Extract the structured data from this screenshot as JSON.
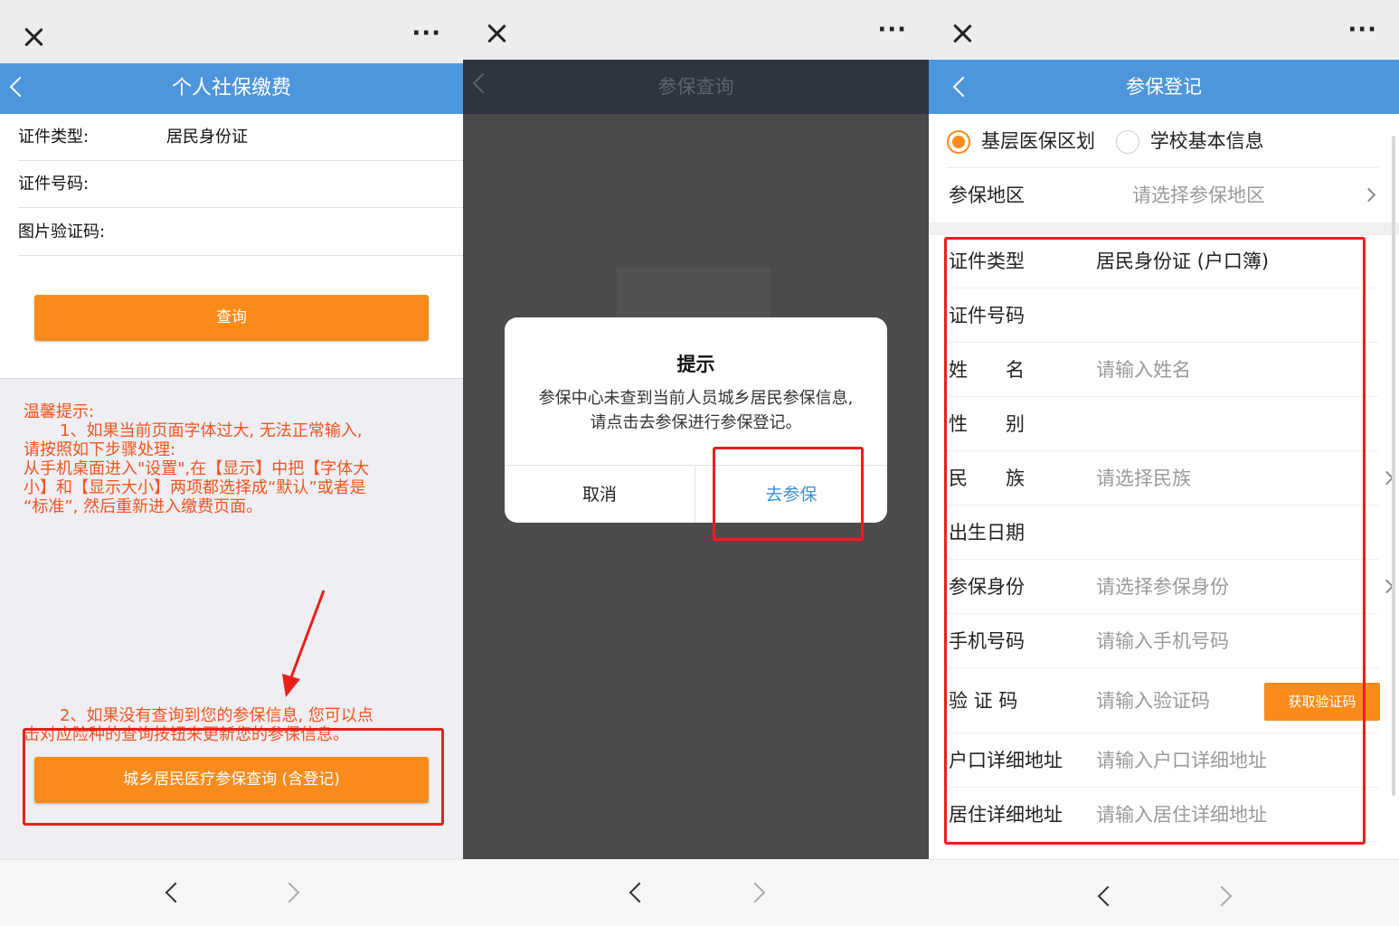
{
  "panel1": {
    "nav_title": "个人社保缴费",
    "fields": [
      {
        "label": "证件类型:",
        "value": "居民身份证"
      },
      {
        "label": "证件号码:",
        "value": ""
      },
      {
        "label": "图片验证码:",
        "value": ""
      }
    ],
    "query_button": "查询",
    "tips": [
      "温馨提示:",
      "1、如果当前页面字体过大, 无法正常输入,",
      "请按照如下步骤处理:",
      "从手机桌面进入\"设置\",在【显示】中把【字体大",
      "小】和【显示大小】两项都选择成“默认”或者是",
      "“标准”, 然后重新进入缴费页面。"
    ],
    "tip2": [
      "2、如果没有查询到您的参保信息, 您可以点",
      "击对应险种的查询按钮来更新您的参保信息。"
    ],
    "medical_query_button": "城乡居民医疗参保查询 (含登记)"
  },
  "panel2": {
    "nav_title": "参保查询",
    "dialog": {
      "title": "提示",
      "message": "参保中心未查到当前人员城乡居民参保信息, 请点击去参保进行参保登记。",
      "cancel": "取消",
      "confirm": "去参保"
    }
  },
  "panel3": {
    "nav_title": "参保登记",
    "radios": [
      {
        "label": "基层医保区划",
        "selected": true
      },
      {
        "label": "学校基本信息",
        "selected": false
      }
    ],
    "region": {
      "label": "参保地区",
      "placeholder": "请选择参保地区"
    },
    "fields": [
      {
        "label": "证件类型",
        "value": "居民身份证 (户口簿)",
        "placeholder": false,
        "chevron": false
      },
      {
        "label": "证件号码",
        "value": "",
        "placeholder": false,
        "chevron": false
      },
      {
        "label": "姓　　名",
        "value": "请输入姓名",
        "placeholder": true,
        "chevron": false
      },
      {
        "label": "性　　别",
        "value": "",
        "placeholder": false,
        "chevron": false
      },
      {
        "label": "民　　族",
        "value": "请选择民族",
        "placeholder": true,
        "chevron": true
      },
      {
        "label": "出生日期",
        "value": "",
        "placeholder": false,
        "chevron": false
      },
      {
        "label": "参保身份",
        "value": "请选择参保身份",
        "placeholder": true,
        "chevron": true
      },
      {
        "label": "手机号码",
        "value": "请输入手机号码",
        "placeholder": true,
        "chevron": false
      },
      {
        "label": "验 证 码",
        "value": "请输入验证码",
        "placeholder": true,
        "chevron": false
      },
      {
        "label": "户口详细地址",
        "value": "请输入户口详细地址",
        "placeholder": true,
        "chevron": false
      },
      {
        "label": "居住详细地址",
        "value": "请输入居住详细地址",
        "placeholder": true,
        "chevron": false
      }
    ],
    "get_code_button": "获取验证码"
  },
  "icons": {
    "close": "close-icon",
    "more": "more-icon",
    "back": "chevron-left-icon",
    "forward": "chevron-right-icon"
  },
  "colors": {
    "nav_blue": "#4d96dc",
    "accent_orange": "#f98b1c",
    "tip_red": "#f2541d",
    "highlight_red": "#e8201b",
    "link_blue": "#3a8fd6"
  }
}
